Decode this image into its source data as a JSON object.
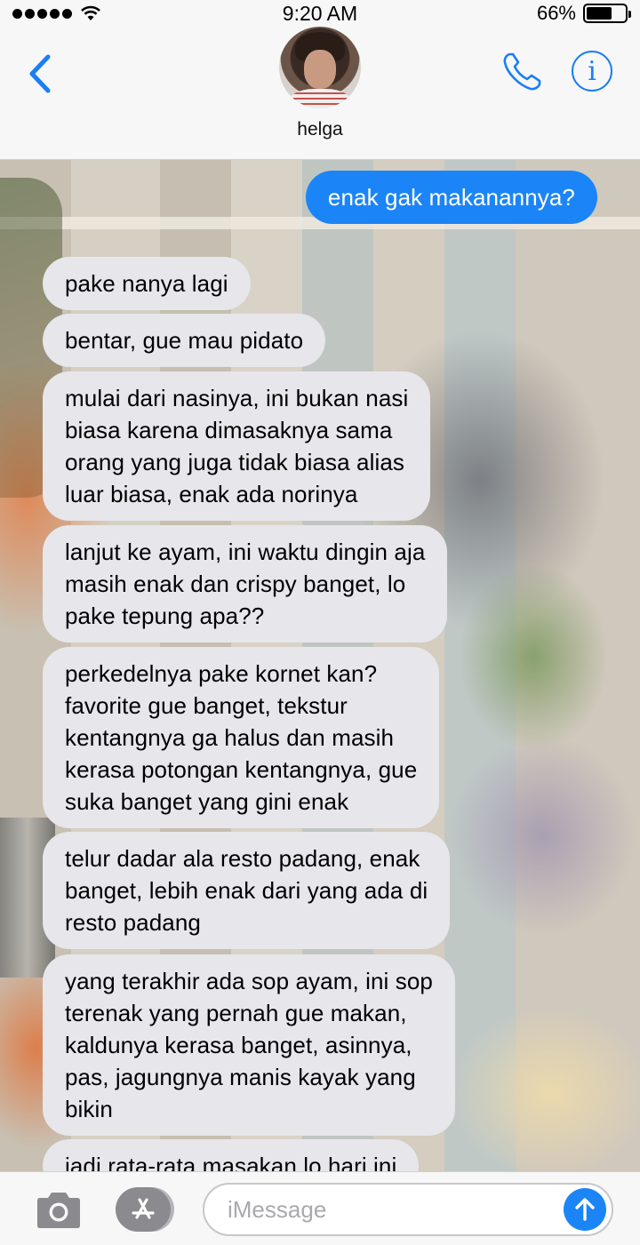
{
  "status_bar": {
    "time": "9:20 AM",
    "battery_text": "66%",
    "battery_level": 0.66,
    "signal_bars": 5,
    "wifi_icon": "wifi-icon"
  },
  "header": {
    "contact_name": "helga",
    "back_icon": "chevron-left-icon",
    "call_icon": "phone-icon",
    "info_icon": "info-icon",
    "info_glyph": "i"
  },
  "messages": [
    {
      "direction": "out",
      "text": "enak gak makanannya?"
    },
    {
      "direction": "in",
      "text": "pake nanya lagi"
    },
    {
      "direction": "in",
      "text": "bentar, gue mau pidato"
    },
    {
      "direction": "in",
      "text": "mulai dari nasinya, ini bukan nasi\nbiasa karena dimasaknya sama\norang yang juga tidak biasa alias\nluar biasa, enak ada norinya"
    },
    {
      "direction": "in",
      "text": "lanjut ke ayam, ini waktu dingin aja\nmasih enak dan crispy banget, lo\npake tepung apa??"
    },
    {
      "direction": "in",
      "text": "perkedelnya pake kornet kan?\nfavorite gue banget, tekstur\nkentangnya ga halus dan masih\nkerasa potongan kentangnya, gue\nsuka banget yang gini enak"
    },
    {
      "direction": "in",
      "text": "telur dadar ala resto padang, enak\nbanget, lebih enak dari yang ada di\nresto padang"
    },
    {
      "direction": "in",
      "text": "yang terakhir ada sop ayam, ini sop\nterenak yang pernah gue makan,\nkaldunya kerasa banget, asinnya,\npas, jagungnya manis kayak yang\nbikin"
    },
    {
      "direction": "in",
      "text": "jadi rata-rata masakan lo hari ini"
    }
  ],
  "input_bar": {
    "placeholder": "iMessage",
    "value": "",
    "camera_icon": "camera-icon",
    "appstore_icon": "app-store-icon",
    "send_icon": "send-arrow-icon"
  },
  "colors": {
    "accent": "#1b85f7",
    "incoming_bubble": "#e6e6eb",
    "outgoing_bubble": "#1b85f7"
  }
}
